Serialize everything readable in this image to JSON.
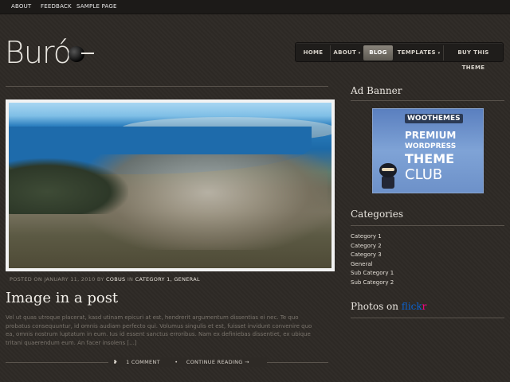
{
  "topbar": {
    "links": [
      "About",
      "Feedback",
      "Sample Page"
    ]
  },
  "logo": {
    "text": "Buró"
  },
  "nav": {
    "items": [
      {
        "label": "HOME",
        "active": false,
        "dropdown": false
      },
      {
        "label": "ABOUT",
        "active": false,
        "dropdown": true
      },
      {
        "label": "BLOG",
        "active": true,
        "dropdown": false
      },
      {
        "label": "TEMPLATES",
        "active": false,
        "dropdown": true
      },
      {
        "label": "BUY THIS THEME",
        "active": false,
        "dropdown": false
      }
    ],
    "dropdown_icon": "caret-down-icon"
  },
  "post": {
    "meta_prefix": "POSTED ON JANUARY 11, 2010 BY",
    "author": "COBUS",
    "in_label": "IN",
    "categories": "CATEGORY 1, GENERAL",
    "title": "Image in a post",
    "excerpt": "Vel ut quas utroque placerat, kasd utinam epicuri at est, hendrerit argumentum dissentias ei nec. Te quo probatus consequuntur, id omnis audiam perfecto qui. Volumus singulis et est, fuisset invidunt convenire quo ea, omnis nostrum luptatum in eum. Ius id essent sanctus erroribus. Nam ex definiebas dissentiet, ex ubique tritani quaerendum eum. An facer insolens [...]",
    "comments": "1 COMMENT",
    "continue": "CONTINUE READING →",
    "comment_icon": "speech-bubble-icon",
    "continue_icon": "bullet-icon"
  },
  "sidebar": {
    "ad_title": "Ad Banner",
    "ad": {
      "brand": "WOOTHEMES",
      "line1": "PREMIUM",
      "line2": "WORDPRESS",
      "line3": "THEME",
      "line4": "CLUB"
    },
    "categories_title": "Categories",
    "categories": [
      "Category 1",
      "Category 2",
      "Category 3",
      "General",
      "Sub Category 1",
      "Sub Category 2"
    ],
    "photos_title_prefix": "Photos on",
    "photos_flickr_a": "flick",
    "photos_flickr_b": "r"
  },
  "colors": {
    "background": "#2e2a26",
    "topbar": "#1c1a18",
    "nav_active": "#7a756d",
    "flickr_blue": "#0a63d2",
    "flickr_pink": "#ff0084"
  }
}
